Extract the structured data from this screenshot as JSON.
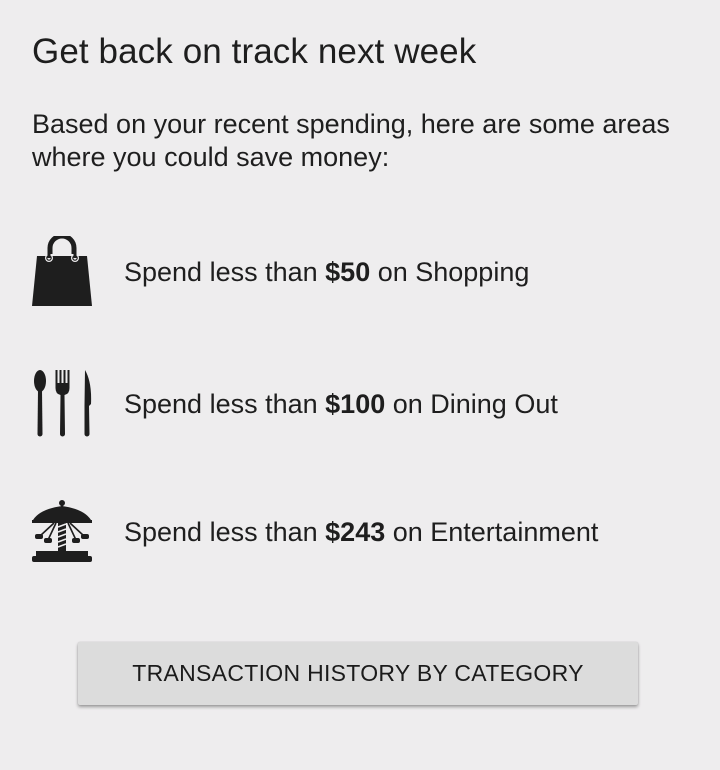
{
  "header": {
    "title": "Get back on track next week",
    "subtitle": "Based on your recent spending, here are some areas where you could save money:"
  },
  "tips": [
    {
      "icon": "shopping-bag-icon",
      "prefix": "Spend less than ",
      "amount": "$50",
      "suffix": " on Shopping"
    },
    {
      "icon": "cutlery-icon",
      "prefix": "Spend less than ",
      "amount": "$100",
      "suffix": " on Dining Out"
    },
    {
      "icon": "carousel-icon",
      "prefix": "Spend less than ",
      "amount": "$243",
      "suffix": " on Entertainment"
    }
  ],
  "actions": {
    "history_button": "TRANSACTION HISTORY BY CATEGORY"
  },
  "colors": {
    "background": "#eeedee",
    "button": "#dcdcdc",
    "icon": "#1e1e1e"
  }
}
